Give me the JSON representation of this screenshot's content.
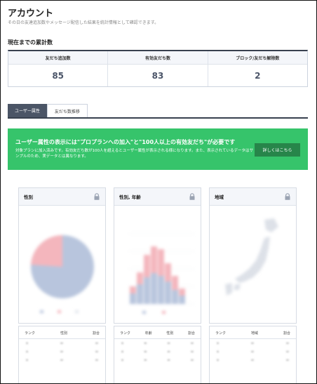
{
  "page": {
    "title": "アカウント",
    "subtitle": "その日の友達追加数やメッセージ配信した結果を統計情報として確認できます。"
  },
  "cumulative": {
    "heading": "現在までの累計数",
    "stats": [
      {
        "label": "友だち追加数",
        "value": "85"
      },
      {
        "label": "有効友だち数",
        "value": "83"
      },
      {
        "label": "ブロック/友だち解除数",
        "value": "2"
      }
    ]
  },
  "tabs": [
    {
      "label": "ユーザー属性",
      "active": true
    },
    {
      "label": "友だち数推移",
      "active": false
    }
  ],
  "notice": {
    "heading": "ユーザー属性の表示には\"プロプランへの加入\"と\"100人以上の有効友だち\"が必要です",
    "text": "対象プランに加入済みです。有効友だち数が100人を超えるとユーザー属性が表示される様になります。また、表示されているデータはサンプルのため、実データとは異なります。",
    "button": "詳しくはこちら"
  },
  "cards": [
    {
      "title": "性別",
      "lock_icon": "lock-icon"
    },
    {
      "title": "性別, 年齢",
      "lock_icon": "lock-icon"
    },
    {
      "title": "地域",
      "lock_icon": "lock-icon"
    }
  ],
  "tables": [
    {
      "headers": [
        "ランク",
        "性別",
        "割合"
      ]
    },
    {
      "headers": [
        "ランク",
        "年齢",
        "性別",
        "割合"
      ]
    },
    {
      "headers": [
        "ランク",
        "地域",
        "割合"
      ]
    }
  ],
  "colors": {
    "accent_green": "#36c46b",
    "button_green": "#27854a",
    "dark_tab": "#4b5566",
    "chart_blue": "#b8c5dd",
    "chart_pink": "#f4b6bd"
  }
}
